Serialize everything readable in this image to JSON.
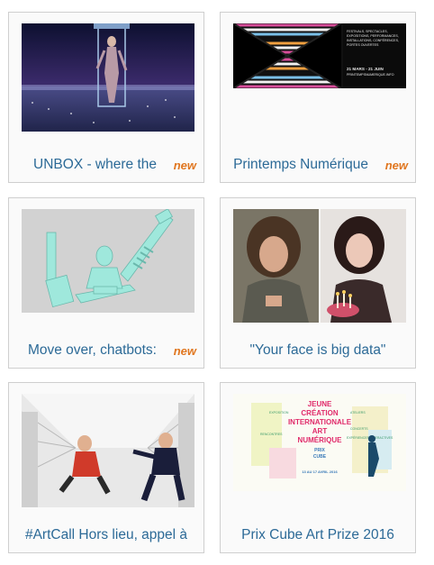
{
  "cards": [
    {
      "title": "UNBOX - where the",
      "badge": "new"
    },
    {
      "title": "Printemps Numérique",
      "badge": "new"
    },
    {
      "title": "Move over, chatbots:",
      "badge": "new"
    },
    {
      "title": "\"Your face is big data\"",
      "badge": ""
    },
    {
      "title": "#ArtCall Hors lieu, appel à",
      "badge": ""
    },
    {
      "title": "Prix Cube Art Prize 2016",
      "badge": ""
    }
  ],
  "thumb_text": {
    "printemps_lines": [
      "FESTIVALS, SPECTACLES,",
      "EXPOSITIONS, PERFORMANCES,",
      "INSTALLATIONS, CONFÉRENCES,",
      "PORTES OUVERTES"
    ],
    "printemps_dates": "21 MARS - 21 JUIN",
    "printemps_site": "PRINTEMPSNUMERIQUE.INFO",
    "cube_lines": [
      "JEUNE",
      "CRÉATION",
      "INTERNATIONALE",
      "ART",
      "NUMÉRIQUE"
    ],
    "cube_prix": "PRIX",
    "cube_name": "CUBE",
    "cube_dates": "13 AU 17 AVRIL 2016",
    "cube_tags": [
      "EXPOSITION",
      "ATELIERS",
      "RENCONTRES",
      "CONCERTS",
      "EXPÉRIENCES INTERACTIVES"
    ]
  },
  "colors": {
    "link": "#2c6a97",
    "badge": "#e0761f",
    "border": "#cfcfcf"
  }
}
